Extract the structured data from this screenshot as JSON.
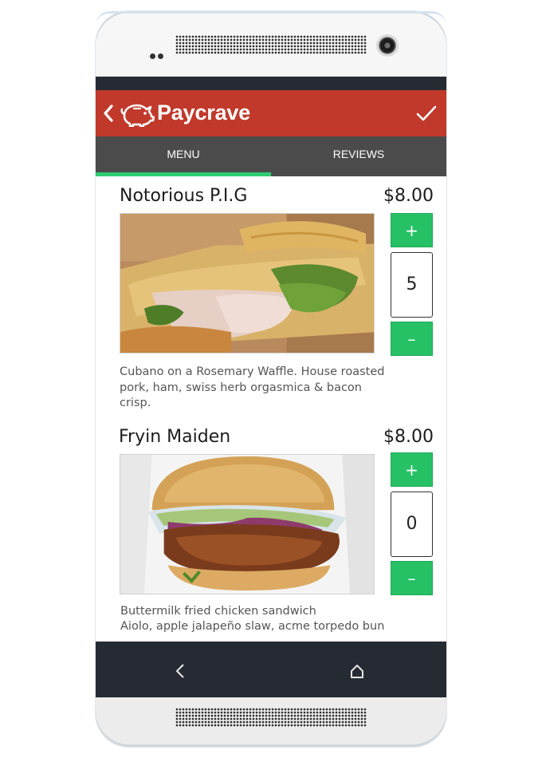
{
  "app": {
    "brand": "Paycrave",
    "accent_color": "#c0392b",
    "tab_indicator_color": "#2ecc71"
  },
  "tabs": [
    {
      "label": "MENU",
      "active": true
    },
    {
      "label": "REVIEWS",
      "active": false
    }
  ],
  "items": [
    {
      "title": "Notorious P.I.G",
      "price": "$8.00",
      "quantity": "5",
      "plus": "+",
      "minus": "–",
      "description": "Cubano on a Rosemary Waffle. House roasted pork, ham, swiss herb orgasmica & bacon crisp."
    },
    {
      "title": "Fryin Maiden",
      "price": "$8.00",
      "quantity": "0",
      "plus": "+",
      "minus": "–",
      "description_line1": "Buttermilk fried chicken sandwich",
      "description_line2": "Aiolo, apple jalapeño slaw, acme torpedo bun"
    }
  ],
  "icons": {
    "back": "chevron-left-icon",
    "logo": "pig-icon",
    "confirm": "checkmark-icon",
    "nav_back": "nav-back-icon",
    "nav_home": "home-icon"
  }
}
